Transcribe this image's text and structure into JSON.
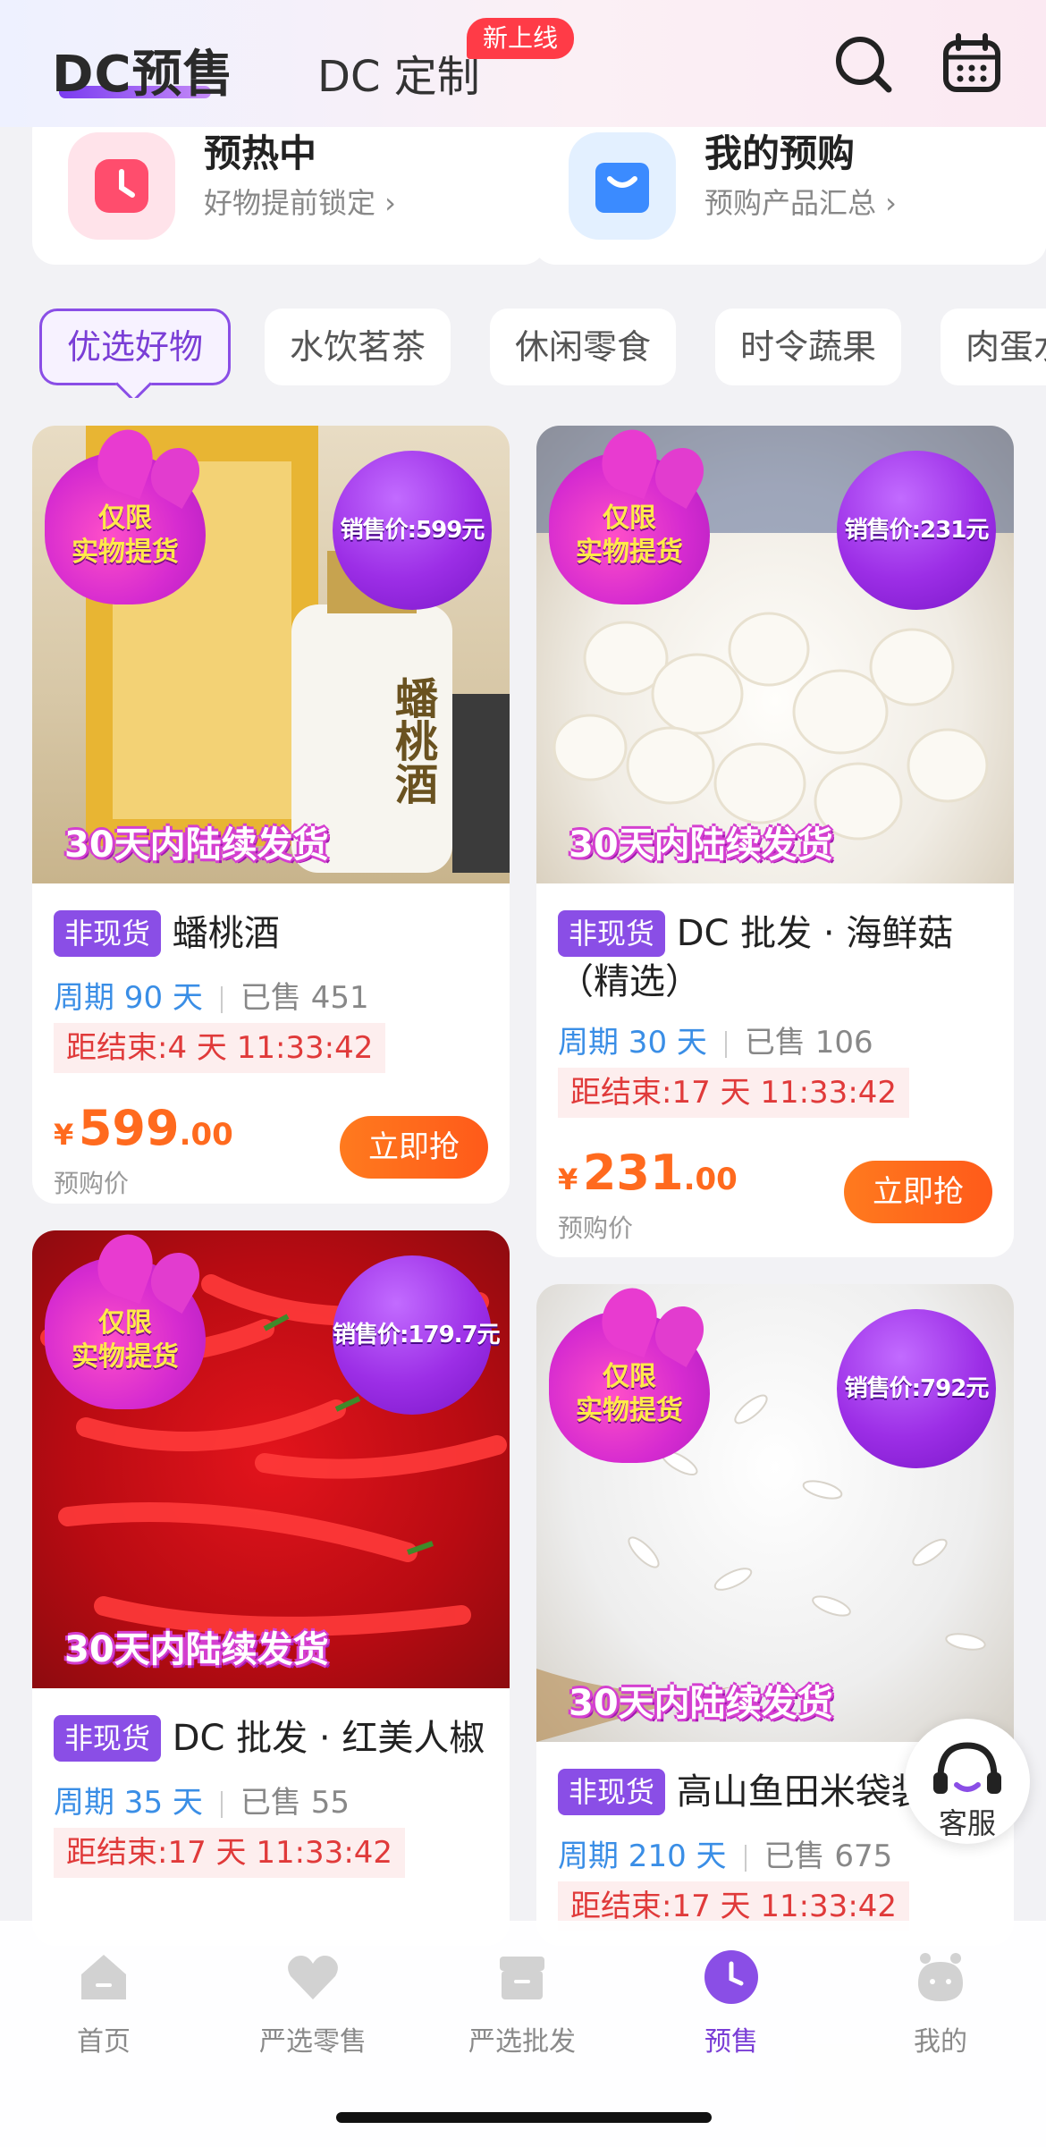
{
  "header": {
    "tab_presale": "DC预售",
    "tab_custom": "DC 定制",
    "new_badge": "新上线"
  },
  "top_cards": [
    {
      "title": "预热中",
      "subtitle": "好物提前锁定 ›",
      "icon": "clock-icon",
      "color": "#ff4d6d"
    },
    {
      "title": "我的预购",
      "subtitle": "预购产品汇总 ›",
      "icon": "shopping-bag-icon",
      "color": "#3b8bff"
    }
  ],
  "categories": [
    "优选好物",
    "水饮茗茶",
    "休闲零食",
    "时令蔬果",
    "肉蛋水"
  ],
  "products": [
    {
      "flame_line1": "仅限",
      "flame_line2": "实物提货",
      "price_bubble": "销售价:599元",
      "shipping": "30天内陆续发货",
      "image_text": "蟠桃酒",
      "tag": "非现货",
      "name": "蟠桃酒",
      "period": "周期 90 天",
      "sold": "已售 451",
      "countdown": "距结束:4 天 11:33:42",
      "currency": "¥",
      "price_int": "599",
      "price_dec": ".00",
      "price_label": "预购价",
      "buy": "立即抢"
    },
    {
      "flame_line1": "仅限",
      "flame_line2": "实物提货",
      "price_bubble": "销售价:231元",
      "shipping": "30天内陆续发货",
      "tag": "非现货",
      "name": "DC 批发 · 海鲜菇（精选）",
      "period": "周期 30 天",
      "sold": "已售 106",
      "countdown": "距结束:17 天 11:33:42",
      "currency": "¥",
      "price_int": "231",
      "price_dec": ".00",
      "price_label": "预购价",
      "buy": "立即抢"
    },
    {
      "flame_line1": "仅限",
      "flame_line2": "实物提货",
      "price_bubble": "销售价:179.7元",
      "shipping": "30天内陆续发货",
      "tag": "非现货",
      "name": "DC 批发 · 红美人椒",
      "period": "周期 35 天",
      "sold": "已售 55",
      "countdown": "距结束:17 天 11:33:42"
    },
    {
      "flame_line1": "仅限",
      "flame_line2": "实物提货",
      "price_bubble": "销售价:792元",
      "shipping": "30天内陆续发货",
      "tag": "非现货",
      "name": "高山鱼田米袋装",
      "period": "周期 210 天",
      "sold": "已售 675",
      "countdown": "距结束:17 天 11:33:42"
    }
  ],
  "service": {
    "label": "客服"
  },
  "nav": [
    {
      "label": "首页",
      "icon": "home-icon"
    },
    {
      "label": "严选零售",
      "icon": "heart-icon"
    },
    {
      "label": "严选批发",
      "icon": "store-icon"
    },
    {
      "label": "预售",
      "icon": "clock-icon",
      "active": true
    },
    {
      "label": "我的",
      "icon": "profile-icon"
    }
  ],
  "colors": {
    "accent": "#8a4ee6",
    "price": "#ff6a1e",
    "countdown": "#e03a3a",
    "period": "#3a8ee6"
  }
}
